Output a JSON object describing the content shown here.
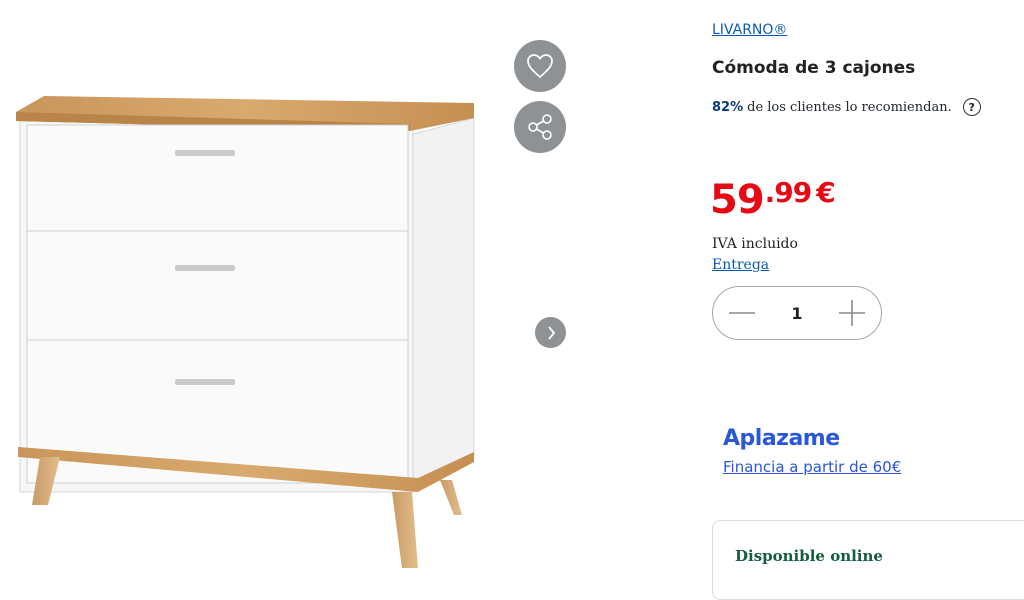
{
  "product": {
    "brand": "LIVARNO®",
    "title": "Cómoda de 3 cajones",
    "recommend_percent": "82%",
    "recommend_text": "de los clientes lo recomiendan.",
    "help_symbol": "?",
    "price": {
      "integer": "59",
      "decimal": ".99",
      "currency": "€"
    },
    "vat_text": "IVA incluido",
    "delivery_link": "Entrega",
    "quantity": "1"
  },
  "gallery": {
    "favorite_icon": "heart-icon",
    "share_icon": "share-icon",
    "next_icon": "chevron-right-icon"
  },
  "financing": {
    "logo_text": "Aplazame",
    "link_text": "Financia a partir de 60€"
  },
  "availability": {
    "text": "Disponible online"
  },
  "colors": {
    "price_red": "#e60a14",
    "link_blue": "#0a5bb0",
    "aplazame_blue": "#2a56d8",
    "availability_green": "#155e3a",
    "icon_button_gray": "#8f9294"
  }
}
